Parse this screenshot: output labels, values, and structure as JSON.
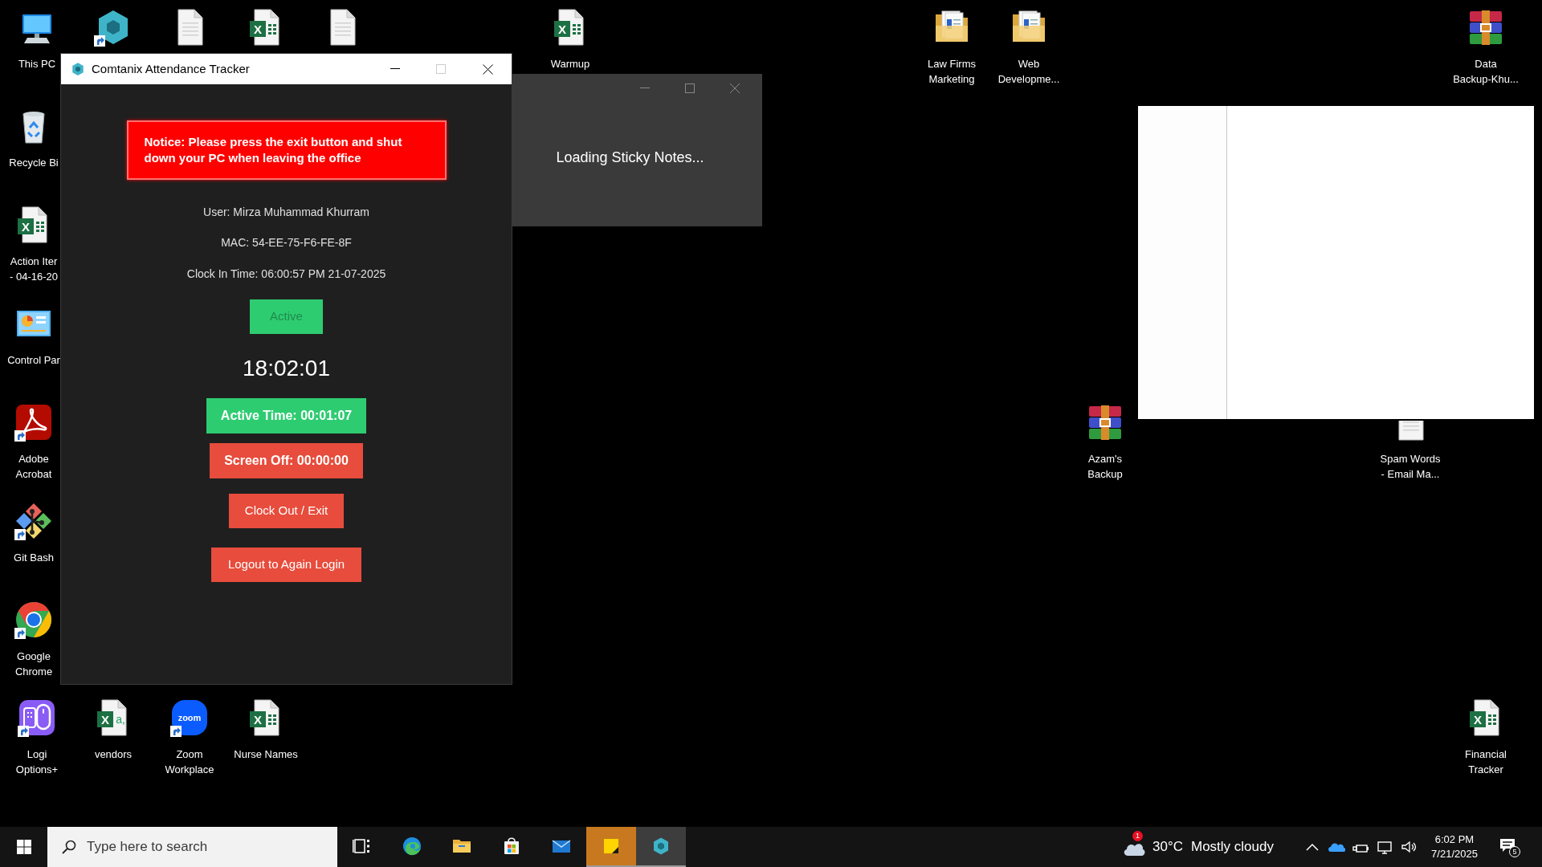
{
  "desktop_icons": [
    {
      "kind": "pc",
      "label": [
        "This PC"
      ],
      "shortcut": false
    },
    {
      "kind": "comtanix",
      "shortcut": true
    },
    {
      "kind": "doc",
      "shortcut": false
    },
    {
      "kind": "excel",
      "glyphs": [
        "X"
      ],
      "shortcut": false
    },
    {
      "kind": "doc",
      "shortcut": false
    },
    {
      "kind": "excel",
      "glyphs": [
        "X"
      ],
      "label": [
        "Warmup"
      ],
      "shortcut": false
    },
    {
      "kind": "folder",
      "label": [
        "Law Firms",
        "Marketing"
      ],
      "shortcut": false
    },
    {
      "kind": "folder",
      "label": [
        "Web",
        "Developme..."
      ],
      "shortcut": false
    },
    {
      "kind": "winrar",
      "label": [
        "Data",
        "Backup-Khu..."
      ],
      "shortcut": false
    },
    {
      "kind": "recycle",
      "label": [
        "Recycle Bi"
      ],
      "shortcut": false
    },
    {
      "kind": "excel",
      "glyphs": [
        "X"
      ],
      "label": [
        "Action Iter",
        "- 04-16-20"
      ],
      "shortcut": false
    },
    {
      "kind": "control",
      "label": [
        "Control Par"
      ],
      "shortcut": false
    },
    {
      "kind": "acrobat",
      "label": [
        "Adobe",
        "Acrobat"
      ],
      "shortcut": true
    },
    {
      "kind": "git",
      "label": [
        "Git Bash"
      ],
      "shortcut": true
    },
    {
      "kind": "chrome",
      "label": [
        "Google",
        "Chrome"
      ],
      "shortcut": true
    },
    {
      "kind": "winrar",
      "label": [
        "Azam's",
        "Backup"
      ],
      "shortcut": false
    },
    {
      "kind": "doc",
      "label": [
        "Spam Words",
        "- Email Ma..."
      ],
      "shortcut": false
    },
    {
      "kind": "logi",
      "label": [
        "Logi",
        "Options+"
      ],
      "shortcut": true
    },
    {
      "kind": "csv",
      "glyphs": [
        "X",
        "a,"
      ],
      "label": [
        "vendors"
      ],
      "shortcut": false
    },
    {
      "kind": "zoom",
      "glyphs": [
        "zoom"
      ],
      "label": [
        "Zoom",
        "Workplace"
      ],
      "shortcut": true
    },
    {
      "kind": "excel",
      "glyphs": [
        "X"
      ],
      "label": [
        "Nurse Names"
      ],
      "shortcut": false
    },
    {
      "kind": "excel",
      "glyphs": [
        "X"
      ],
      "label": [
        "Financial",
        "Tracker"
      ],
      "shortcut": false
    }
  ],
  "attendance_window": {
    "title": "Comtanix Attendance Tracker",
    "maximize_disabled": true,
    "notice": "Notice: Please press the exit button and shut down your PC when leaving the office",
    "info_lines": [
      "User: Mirza Muhammad Khurram",
      "MAC: 54-EE-75-F6-FE-8F",
      "Clock In Time: 06:00:57 PM 21-07-2025"
    ],
    "status_button": {
      "label": "Active",
      "disabled": true
    },
    "clock": "18:02:01",
    "counters": [
      {
        "label": "Active Time: 00:01:07",
        "color": "#2ecc71"
      },
      {
        "label": "Screen Off: 00:00:00",
        "color": "#e74c3c"
      }
    ],
    "buttons": [
      {
        "label": "Clock Out / Exit"
      },
      {
        "label": "Logout to Again Login"
      }
    ]
  },
  "sticky_window": {
    "message": "Loading Sticky Notes..."
  },
  "blank_window": {
    "kind": "blank"
  },
  "taskbar": {
    "search": {
      "placeholder": "Type here to search"
    },
    "apps": [
      {
        "kind": "taskview",
        "open": false,
        "selected": false
      },
      {
        "kind": "edge",
        "open": false,
        "selected": false
      },
      {
        "kind": "explorer",
        "open": false,
        "selected": false
      },
      {
        "kind": "store",
        "open": false,
        "selected": false
      },
      {
        "kind": "mail",
        "open": false,
        "selected": false
      },
      {
        "kind": "sticky",
        "open": true,
        "selected": true
      },
      {
        "kind": "comtanix",
        "open": true,
        "selected": false
      }
    ],
    "weather": {
      "badge": "1",
      "temperature": "30°C",
      "condition": "Mostly cloudy"
    },
    "tray": [
      {
        "kind": "chevron"
      },
      {
        "kind": "onedrive"
      },
      {
        "kind": "usb"
      },
      {
        "kind": "network"
      },
      {
        "kind": "volume"
      }
    ],
    "clock": {
      "time": "6:02 PM",
      "date": "7/21/2025"
    },
    "notifications": {
      "badge": "5"
    }
  }
}
